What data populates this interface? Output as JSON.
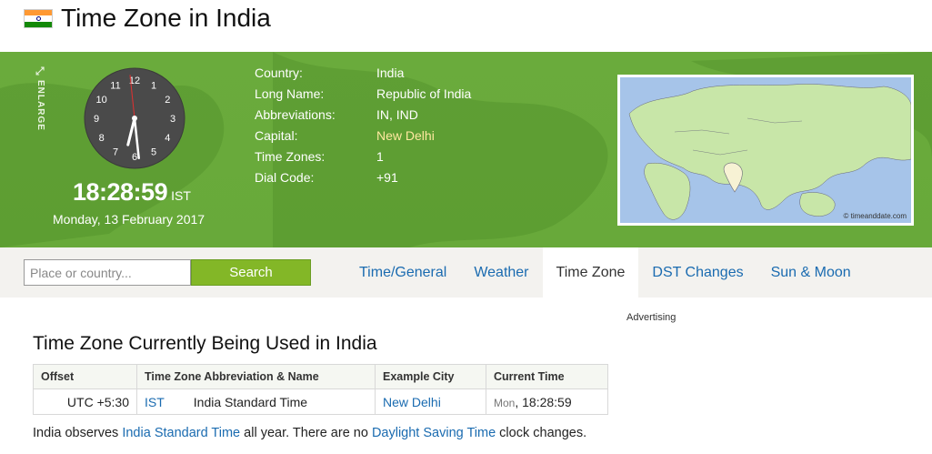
{
  "page": {
    "title": "Time Zone in India"
  },
  "clock": {
    "enlarge_label": "ENLARGE",
    "numbers": [
      "12",
      "1",
      "2",
      "3",
      "4",
      "5",
      "6",
      "7",
      "8",
      "9",
      "10",
      "11"
    ],
    "time": "18:28:59",
    "tz": "IST",
    "date": "Monday, 13 February 2017",
    "hands": {
      "hour": 6,
      "minute": 28,
      "second": 59
    }
  },
  "facts": [
    {
      "key": "Country:",
      "value": "India",
      "link": false
    },
    {
      "key": "Long Name:",
      "value": "Republic of India",
      "link": false
    },
    {
      "key": "Abbreviations:",
      "value": "IN, IND",
      "link": false
    },
    {
      "key": "Capital:",
      "value": "New Delhi",
      "link": true
    },
    {
      "key": "Time Zones:",
      "value": "1",
      "link": false
    },
    {
      "key": "Dial Code:",
      "value": "+91",
      "link": false
    }
  ],
  "map": {
    "credit": "© timeanddate.com"
  },
  "search": {
    "placeholder": "Place or country...",
    "button": "Search"
  },
  "tabs": [
    {
      "label": "Time/General",
      "active": false
    },
    {
      "label": "Weather",
      "active": false
    },
    {
      "label": "Time Zone",
      "active": true
    },
    {
      "label": "DST Changes",
      "active": false
    },
    {
      "label": "Sun & Moon",
      "active": false
    }
  ],
  "advertising": "Advertising",
  "section_title": "Time Zone Currently Being Used in India",
  "table": {
    "headers": [
      "Offset",
      "Time Zone Abbreviation & Name",
      "Example City",
      "Current Time"
    ],
    "rows": [
      {
        "offset": "UTC +5:30",
        "abbr": "IST",
        "name": "India Standard Time",
        "city": "New Delhi",
        "day": "Mon",
        "time": ", 18:28:59"
      }
    ]
  },
  "note": {
    "p1": "India observes ",
    "link1": "India Standard Time",
    "p2": " all year. There are no ",
    "link2": "Daylight Saving Time",
    "p3": " clock changes."
  },
  "colors": {
    "banner": "#6aab3c",
    "link": "#1a6bb0",
    "search_button": "#83b727"
  }
}
